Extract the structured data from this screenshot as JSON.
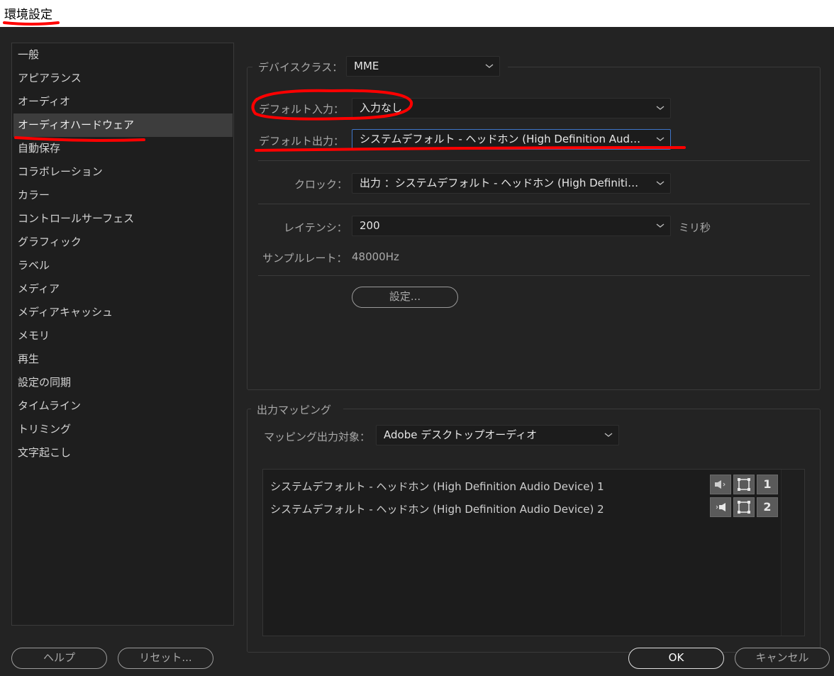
{
  "window": {
    "title": "環境設定"
  },
  "sidebar": {
    "items": [
      {
        "label": "一般"
      },
      {
        "label": "アピアランス"
      },
      {
        "label": "オーディオ"
      },
      {
        "label": "オーディオハードウェア",
        "selected": true
      },
      {
        "label": "自動保存"
      },
      {
        "label": "コラボレーション"
      },
      {
        "label": "カラー"
      },
      {
        "label": "コントロールサーフェス"
      },
      {
        "label": "グラフィック"
      },
      {
        "label": "ラベル"
      },
      {
        "label": "メディア"
      },
      {
        "label": "メディアキャッシュ"
      },
      {
        "label": "メモリ"
      },
      {
        "label": "再生"
      },
      {
        "label": "設定の同期"
      },
      {
        "label": "タイムライン"
      },
      {
        "label": "トリミング"
      },
      {
        "label": "文字起こし"
      }
    ]
  },
  "device": {
    "class_label": "デバイスクラス：",
    "class_value": "MME",
    "default_input_label": "デフォルト入力：",
    "default_input_value": "入力なし",
    "default_output_label": "デフォルト出力：",
    "default_output_value": "システムデフォルト - ヘッドホン (High Definition Audio Device)",
    "clock_label": "クロック：",
    "clock_value": "出力 ：システムデフォルト - ヘッドホン (High Definition Audio Device)",
    "latency_label": "レイテンシ：",
    "latency_value": "200",
    "latency_unit": "ミリ秒",
    "sample_rate_label": "サンプルレート：",
    "sample_rate_value": "48000Hz",
    "settings_button": "設定..."
  },
  "output_mapping": {
    "group_label": "出力マッピング",
    "target_label": "マッピング出力対象：",
    "target_value": "Adobe デスクトップオーディオ",
    "rows": [
      {
        "label": "システムデフォルト - ヘッドホン (High Definition Audio Device) 1",
        "channel": "1",
        "speaker_icon": "speaker-left-icon"
      },
      {
        "label": "システムデフォルト - ヘッドホン (High Definition Audio Device) 2",
        "channel": "2",
        "speaker_icon": "speaker-right-icon"
      }
    ]
  },
  "footer": {
    "help": "ヘルプ",
    "reset": "リセット...",
    "ok": "OK",
    "cancel": "キャンセル"
  },
  "colors": {
    "background": "#232323",
    "annotation": "#ff0000",
    "focus": "#3f76c9"
  }
}
